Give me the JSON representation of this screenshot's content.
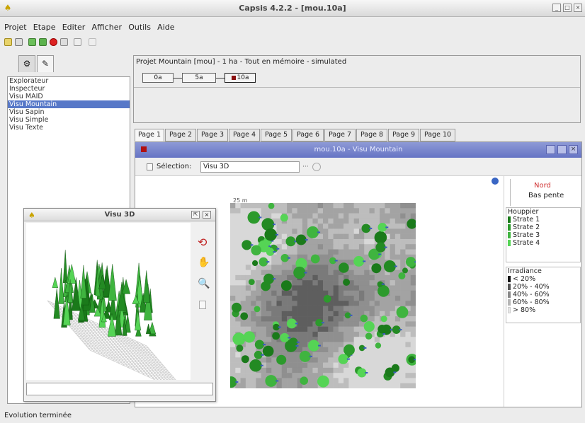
{
  "window": {
    "title": "Capsis 4.2.2 - [mou.10a]"
  },
  "menu": [
    "Projet",
    "Etape",
    "Editer",
    "Afficher",
    "Outils",
    "Aide"
  ],
  "left_panel": {
    "items": [
      "Explorateur",
      "Inspecteur",
      "Visu MAID",
      "Visu Mountain",
      "Visu Sapin",
      "Visu Simple",
      "Visu Texte"
    ],
    "selected": "Visu Mountain"
  },
  "project": {
    "title": "Projet Mountain [mou] - 1 ha - Tout en mémoire - simulated",
    "steps": [
      "0a",
      "5a",
      "10a"
    ]
  },
  "page_tabs": [
    "Page 1",
    "Page 2",
    "Page 3",
    "Page 4",
    "Page 5",
    "Page 6",
    "Page 7",
    "Page 8",
    "Page 9",
    "Page 10"
  ],
  "main_window": {
    "title": "mou.10a - Visu Mountain",
    "selection_label": "Sélection:",
    "selection_value": "Visu 3D",
    "scale_label": "25 m"
  },
  "legend": {
    "nord": "Nord",
    "bas_pente": "Bas pente",
    "houppier_title": "Houppier",
    "strates": [
      "Strate 1",
      "Strate 2",
      "Strate 3",
      "Strate 4"
    ],
    "strate_colors": [
      "#1a7a1a",
      "#2c9a2c",
      "#3fb43f",
      "#55d455"
    ],
    "irradiance_title": "Irradiance",
    "irradiance": [
      "< 20%",
      "20% - 40%",
      "40% - 60%",
      "60% - 80%",
      "> 80%"
    ],
    "irradiance_colors": [
      "#111111",
      "#555555",
      "#888888",
      "#b5b5b5",
      "#e8e8e8"
    ]
  },
  "visu3d": {
    "title": "Visu 3D"
  },
  "status": "Evolution terminée"
}
